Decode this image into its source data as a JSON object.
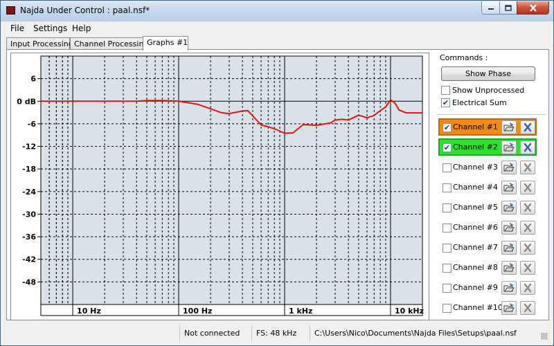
{
  "window": {
    "title": "Najda Under Control : paal.nsf*",
    "minimize_icon": "minimize-icon",
    "maximize_icon": "maximize-icon",
    "close_icon": "close-icon"
  },
  "menu": [
    "File",
    "Settings",
    "Help"
  ],
  "tabs": [
    "Input Processing",
    "Channel Processing",
    "Graphs #1"
  ],
  "active_tab": "Graphs #1",
  "commands": {
    "title": "Commands :",
    "show_phase_label": "Show Phase",
    "show_unprocessed": {
      "label": "Show Unprocessed",
      "checked": false
    },
    "electrical_sum": {
      "label": "Electrical Sum",
      "checked": true
    }
  },
  "channels": [
    {
      "label": "Channel #1",
      "checked": true,
      "highlight": "#f08a1c"
    },
    {
      "label": "Channel #2",
      "checked": true,
      "highlight": "#2fe02f"
    },
    {
      "label": "Channel #3",
      "checked": false
    },
    {
      "label": "Channel #4",
      "checked": false
    },
    {
      "label": "Channel #5",
      "checked": false
    },
    {
      "label": "Channel #6",
      "checked": false
    },
    {
      "label": "Channel #7",
      "checked": false
    },
    {
      "label": "Channel #8",
      "checked": false
    },
    {
      "label": "Channel #9",
      "checked": false
    },
    {
      "label": "Channel #10",
      "checked": false
    }
  ],
  "status": {
    "connection": "Not connected",
    "fs": "FS: 48 kHz",
    "path": "C:\\Users\\Nico\\Documents\\Najda Files\\Setups\\paal.nsf"
  },
  "colors": {
    "plot_bg": "#d9e2e8",
    "curve": "#e81010",
    "channel1": "#f08a1c",
    "channel2": "#2fe02f"
  },
  "chart_data": {
    "type": "line",
    "x_scale": "log",
    "xlim": [
      5,
      20000
    ],
    "ylim": [
      -54,
      12
    ],
    "y_ticks": [
      6,
      0,
      -6,
      -12,
      -18,
      -24,
      -30,
      -36,
      -42,
      -48
    ],
    "y_tick_labels": [
      "6",
      "0 dB",
      "-6",
      "-12",
      "-18",
      "-24",
      "-30",
      "-36",
      "-42",
      "-48"
    ],
    "x_ticks": [
      10,
      100,
      1000,
      10000
    ],
    "x_tick_labels": [
      "10 Hz",
      "100 Hz",
      "1 kHz",
      "10 kHz"
    ],
    "grid": true,
    "series": [
      {
        "x": [
          5,
          10,
          20,
          40,
          50,
          70,
          100,
          150,
          200,
          250,
          300,
          400,
          450,
          600,
          700,
          800,
          1000,
          1200,
          1500,
          2000,
          2300,
          2700,
          3000,
          3500,
          4000,
          5000,
          6000,
          7000,
          8000,
          9000,
          10000,
          11000,
          12000,
          14000,
          20000
        ],
        "y": [
          0,
          0,
          0,
          0,
          0.2,
          0.2,
          0,
          -0.8,
          -2,
          -3,
          -3.3,
          -2.6,
          -2.5,
          -6.3,
          -6.8,
          -7.3,
          -8.5,
          -8.4,
          -6.2,
          -6.4,
          -6.1,
          -5.8,
          -5,
          -4.8,
          -5,
          -3.7,
          -4.4,
          -3.8,
          -2.5,
          -1.5,
          0.4,
          -0.5,
          -2.3,
          -3.1,
          -3.1
        ]
      }
    ]
  }
}
